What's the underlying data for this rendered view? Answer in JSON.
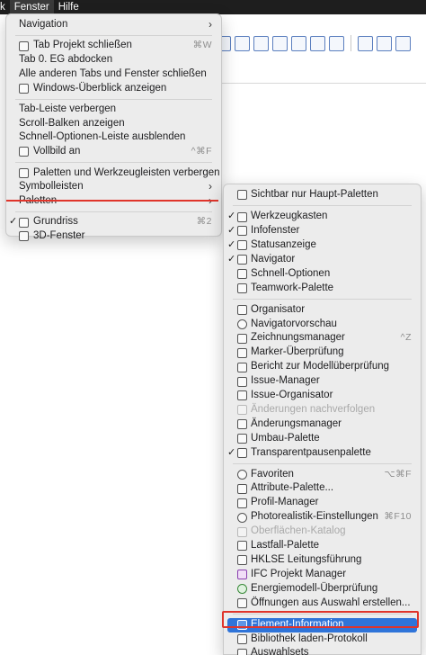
{
  "menubar": {
    "items": [
      "k",
      "Fenster",
      "Hilfe"
    ]
  },
  "main_menu": {
    "items": [
      {
        "label": "Navigation",
        "submenu": true
      },
      {
        "sep": true
      },
      {
        "label": "Tab Projekt schließen",
        "shortcut": "⌘W",
        "icon": "close-tab-icon"
      },
      {
        "label": "Tab 0. EG abdocken"
      },
      {
        "label": "Alle anderen Tabs und Fenster schließen"
      },
      {
        "label": "Windows-Überblick anzeigen",
        "icon": "grid-icon"
      },
      {
        "sep": true
      },
      {
        "label": "Tab-Leiste verbergen"
      },
      {
        "label": "Scroll-Balken anzeigen"
      },
      {
        "label": "Schnell-Optionen-Leiste ausblenden"
      },
      {
        "label": "Vollbild an",
        "shortcut": "^⌘F",
        "icon": "fullscreen-icon"
      },
      {
        "sep": true
      },
      {
        "label": "Paletten und Werkzeugleisten verbergen",
        "icon": "palette-icon"
      },
      {
        "label": "Symbolleisten",
        "submenu": true
      },
      {
        "label": "Paletten",
        "submenu": true
      },
      {
        "sep": true
      },
      {
        "label": "Grundriss",
        "shortcut": "⌘2",
        "icon": "floorplan-icon",
        "checked": true
      },
      {
        "label": "3D-Fenster",
        "icon": "3d-window-icon"
      }
    ]
  },
  "palettes_menu": {
    "items": [
      {
        "label": "Sichtbar nur Haupt-Paletten",
        "icon": "main-palettes-icon"
      },
      {
        "sep": true
      },
      {
        "label": "Werkzeugkasten",
        "checked": true,
        "icon": "toolbox-icon"
      },
      {
        "label": "Infofenster",
        "checked": true,
        "icon": "info-icon"
      },
      {
        "label": "Statusanzeige",
        "checked": true,
        "icon": "status-icon"
      },
      {
        "label": "Navigator",
        "checked": true,
        "icon": "navigator-icon"
      },
      {
        "label": "Schnell-Optionen",
        "icon": "quick-options-icon"
      },
      {
        "label": "Teamwork-Palette",
        "icon": "teamwork-icon"
      },
      {
        "sep": true
      },
      {
        "label": "Organisator",
        "icon": "organizer-icon"
      },
      {
        "label": "Navigatorvorschau",
        "icon": "preview-icon"
      },
      {
        "label": "Zeichnungsmanager",
        "shortcut": "^Z",
        "icon": "drawing-manager-icon"
      },
      {
        "label": "Marker-Überprüfung",
        "icon": "marker-check-icon"
      },
      {
        "label": "Bericht zur Modellüberprüfung",
        "icon": "report-icon"
      },
      {
        "label": "Issue-Manager",
        "icon": "issue-manager-icon"
      },
      {
        "label": "Issue-Organisator",
        "icon": "issue-organizer-icon"
      },
      {
        "label": "Änderungen nachverfolgen",
        "disabled": true,
        "icon": "track-changes-icon"
      },
      {
        "label": "Änderungsmanager",
        "icon": "change-manager-icon"
      },
      {
        "label": "Umbau-Palette",
        "icon": "renovation-icon"
      },
      {
        "label": "Transparentpausenpalette",
        "checked": true,
        "icon": "trace-icon"
      },
      {
        "sep": true
      },
      {
        "label": "Favoriten",
        "shortcut": "⌥⌘F",
        "icon": "star-icon"
      },
      {
        "label": "Attribute-Palette...",
        "icon": "attribute-icon"
      },
      {
        "label": "Profil-Manager",
        "icon": "profile-icon"
      },
      {
        "label": "Photorealistik-Einstellungen",
        "shortcut": "⌘F10",
        "icon": "render-icon"
      },
      {
        "label": "Oberflächen-Katalog",
        "disabled": true,
        "icon": "surface-icon"
      },
      {
        "label": "Lastfall-Palette",
        "icon": "loadcase-icon"
      },
      {
        "label": "HKLSE Leitungsführung",
        "icon": "mep-icon"
      },
      {
        "label": "IFC Projekt Manager",
        "icon": "ifc-icon"
      },
      {
        "label": "Energiemodell-Überprüfung",
        "icon": "energy-icon"
      },
      {
        "label": "Öffnungen aus Auswahl erstellen...",
        "icon": "openings-icon"
      },
      {
        "sep": true
      },
      {
        "label": "Element-Information",
        "icon": "element-info-icon",
        "highlighted": true
      },
      {
        "label": "Bibliothek laden-Protokoll",
        "icon": "library-log-icon"
      },
      {
        "label": "Auswahlsets",
        "icon": "selection-sets-icon"
      }
    ]
  },
  "colors": {
    "highlight": "#2f74d9",
    "annotation_red": "#e0342a"
  }
}
